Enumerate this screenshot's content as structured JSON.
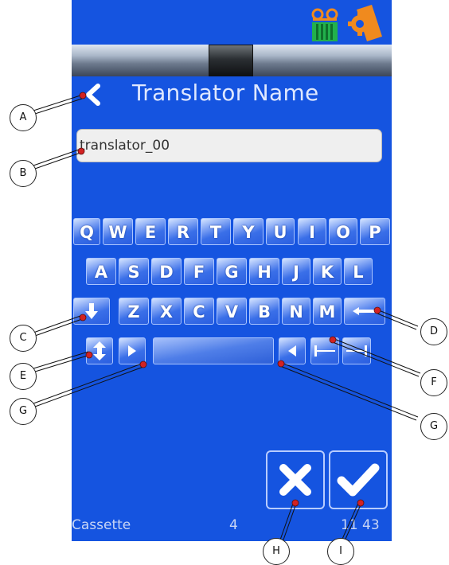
{
  "screen": {
    "title": "Translator Name",
    "name_field_value": "translator_00",
    "icons": {
      "top": [
        "cassette-icon",
        "settings-icon"
      ],
      "back": "back-chevron-icon"
    },
    "keyboard": {
      "row1": [
        "Q",
        "W",
        "E",
        "R",
        "T",
        "Y",
        "U",
        "I",
        "O",
        "P"
      ],
      "row2": [
        "A",
        "S",
        "D",
        "F",
        "G",
        "H",
        "J",
        "K",
        "L"
      ],
      "row3": [
        "Z",
        "X",
        "C",
        "V",
        "B",
        "N",
        "M"
      ]
    },
    "status": {
      "label": "Cassette",
      "count": "4",
      "time": "11 43"
    }
  },
  "callouts": {
    "A": "A",
    "B": "B",
    "C": "C",
    "D": "D",
    "E": "E",
    "F": "F",
    "G1": "G",
    "G2": "G",
    "H": "H",
    "I": "I"
  },
  "colors": {
    "screen_bg": "#1554e0",
    "title_text": "#dfe8ff",
    "accent_red": "#d22222",
    "icon_orange": "#f08a1e",
    "icon_green": "#22b14c"
  }
}
